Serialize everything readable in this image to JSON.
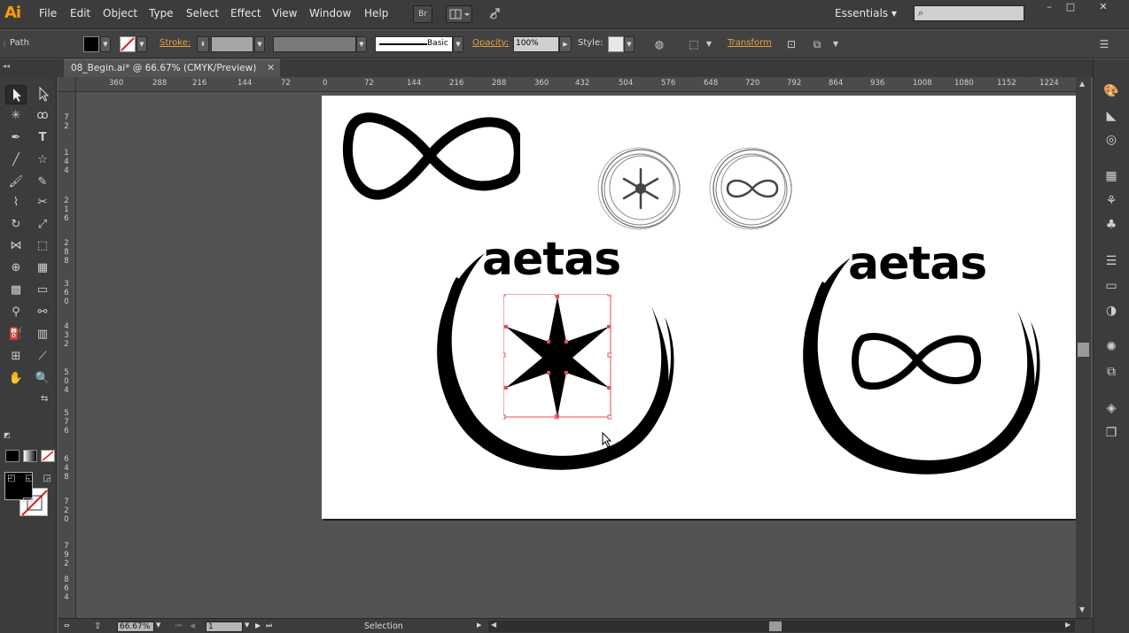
{
  "app": {
    "logo": "Ai"
  },
  "menu": [
    "File",
    "Edit",
    "Object",
    "Type",
    "Select",
    "Effect",
    "View",
    "Window",
    "Help"
  ],
  "menubar_buttons": {
    "bridge": "Br"
  },
  "workspace": {
    "label": "Essentials",
    "arrow": "▾"
  },
  "search": {
    "placeholder": "",
    "icon": "search-icon"
  },
  "window_controls": {
    "minimize": "–",
    "maximize": "□",
    "close": "✕"
  },
  "control_bar": {
    "selection_type": "Path",
    "stroke_label": "Stroke:",
    "brush_label": "Basic",
    "opacity_label": "Opacity:",
    "opacity_value": "100%",
    "style_label": "Style:",
    "transform_label": "Transform"
  },
  "document_tab": {
    "title": "08_Begin.ai* @ 66.67% (CMYK/Preview)",
    "close": "✕"
  },
  "rulers": {
    "horizontal": [
      "360",
      "288",
      "216",
      "144",
      "72",
      "0",
      "72",
      "144",
      "216",
      "288",
      "360",
      "432",
      "504",
      "576",
      "648",
      "720",
      "792",
      "864",
      "936",
      "1008",
      "1080",
      "1152",
      "1224"
    ],
    "vertical": [
      [
        "7",
        "2"
      ],
      [
        "1",
        "4",
        "4"
      ],
      [
        "2",
        "1",
        "6"
      ],
      [
        "2",
        "8",
        "8"
      ],
      [
        "3",
        "6",
        "0"
      ],
      [
        "4",
        "3",
        "2"
      ],
      [
        "5",
        "0",
        "4"
      ],
      [
        "5",
        "7",
        "6"
      ],
      [
        "6",
        "4",
        "8"
      ],
      [
        "7",
        "2",
        "0"
      ],
      [
        "7",
        "9",
        "2"
      ],
      [
        "8",
        "6",
        "4"
      ]
    ]
  },
  "artwork": {
    "wordmark_left": "aetas",
    "wordmark_right": "aetas"
  },
  "status_bar": {
    "zoom": "66.67%",
    "artboard_number": "1",
    "tool_name": "Selection"
  },
  "colors": {
    "selection_highlight": "#e05050",
    "accent_orange": "#e7a23b",
    "ui_dark": "#3c3c3c",
    "canvas_gray": "#535353"
  }
}
